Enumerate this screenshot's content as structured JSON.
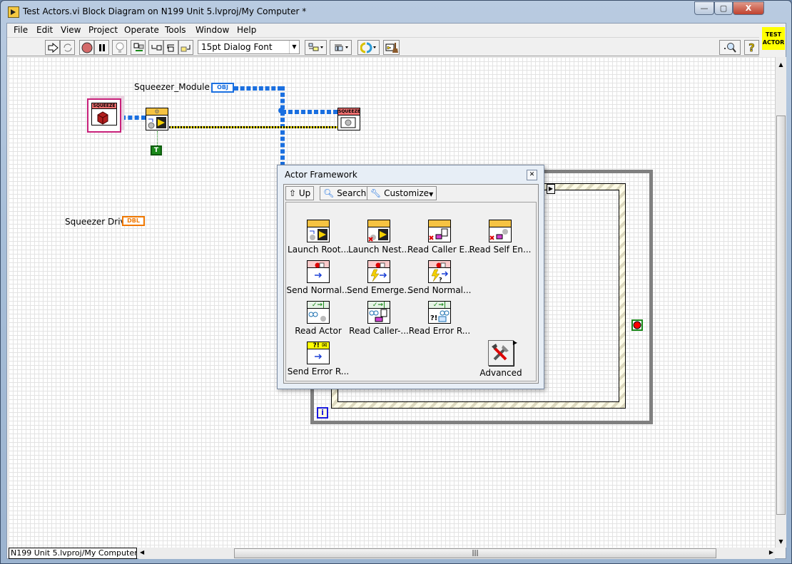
{
  "window": {
    "title": "Test Actors.vi Block Diagram on N199 Unit 5.lvproj/My Computer *",
    "controls": {
      "minimize": "—",
      "maximize": "▢",
      "close": "X"
    }
  },
  "menu": [
    "File",
    "Edit",
    "View",
    "Project",
    "Operate",
    "Tools",
    "Window",
    "Help"
  ],
  "toolbar": {
    "buttons": [
      "run-icon",
      "run-continuously-icon",
      "abort-icon",
      "pause-icon",
      "highlight-execution-icon",
      "retain-wire-values-icon",
      "step-into-icon",
      "step-over-icon",
      "step-out-icon"
    ],
    "font": "15pt Dialog Font",
    "align_menu": "align-objects-icon",
    "distribute_menu": "distribute-objects-icon",
    "reorder_menu": "reorder-icon",
    "cleanup": "clean-up-diagram-icon",
    "search": "search-icon",
    "help": "?"
  },
  "vi_icon": {
    "line1": "TEST",
    "line2": "ACTOR",
    "color": "#ffff00"
  },
  "diagram": {
    "labels": {
      "squeezer_module_in": "Squeezer_Module in",
      "squeezer_drive": "Squeezer Drive"
    },
    "terminals": {
      "obj": "OBJ",
      "dbl": "DBL",
      "true_const": "T",
      "iteration": "i"
    },
    "nodes": {
      "squeezer_constant": "SQUEEZE",
      "squeezer_method": "SQUEEZE"
    },
    "colors": {
      "class_wire": "#1a6fe0",
      "error_wire": "#d6c800",
      "dbl": "#f07800",
      "bool": "#1a8a1a"
    }
  },
  "palette": {
    "title": "Actor Framework",
    "buttons": {
      "up": "Up",
      "search": "Search",
      "customize": "Customize"
    },
    "items": [
      {
        "label": "Launch Root...",
        "icon": "launch-root-actor-icon"
      },
      {
        "label": "Launch Nest...",
        "icon": "launch-nested-actor-icon"
      },
      {
        "label": "Read Caller E...",
        "icon": "read-caller-enqueuer-icon"
      },
      {
        "label": "Read Self En...",
        "icon": "read-self-enqueuer-icon"
      },
      {
        "label": "Send Normal...",
        "icon": "send-normal-stop-icon"
      },
      {
        "label": "Send Emerge...",
        "icon": "send-emergency-stop-icon"
      },
      {
        "label": "Send Normal...",
        "icon": "send-normal-or-emergency-stop-icon"
      },
      {
        "label": "Read Actor",
        "icon": "read-actor-icon"
      },
      {
        "label": "Read Caller-...",
        "icon": "read-caller-to-actor-icon"
      },
      {
        "label": "Read Error R...",
        "icon": "read-error-report-icon"
      },
      {
        "label": "Send Error R...",
        "icon": "send-error-report-icon"
      }
    ],
    "advanced": "Advanced"
  },
  "statusbar": {
    "context": "N199 Unit 5.lvproj/My Computer"
  }
}
